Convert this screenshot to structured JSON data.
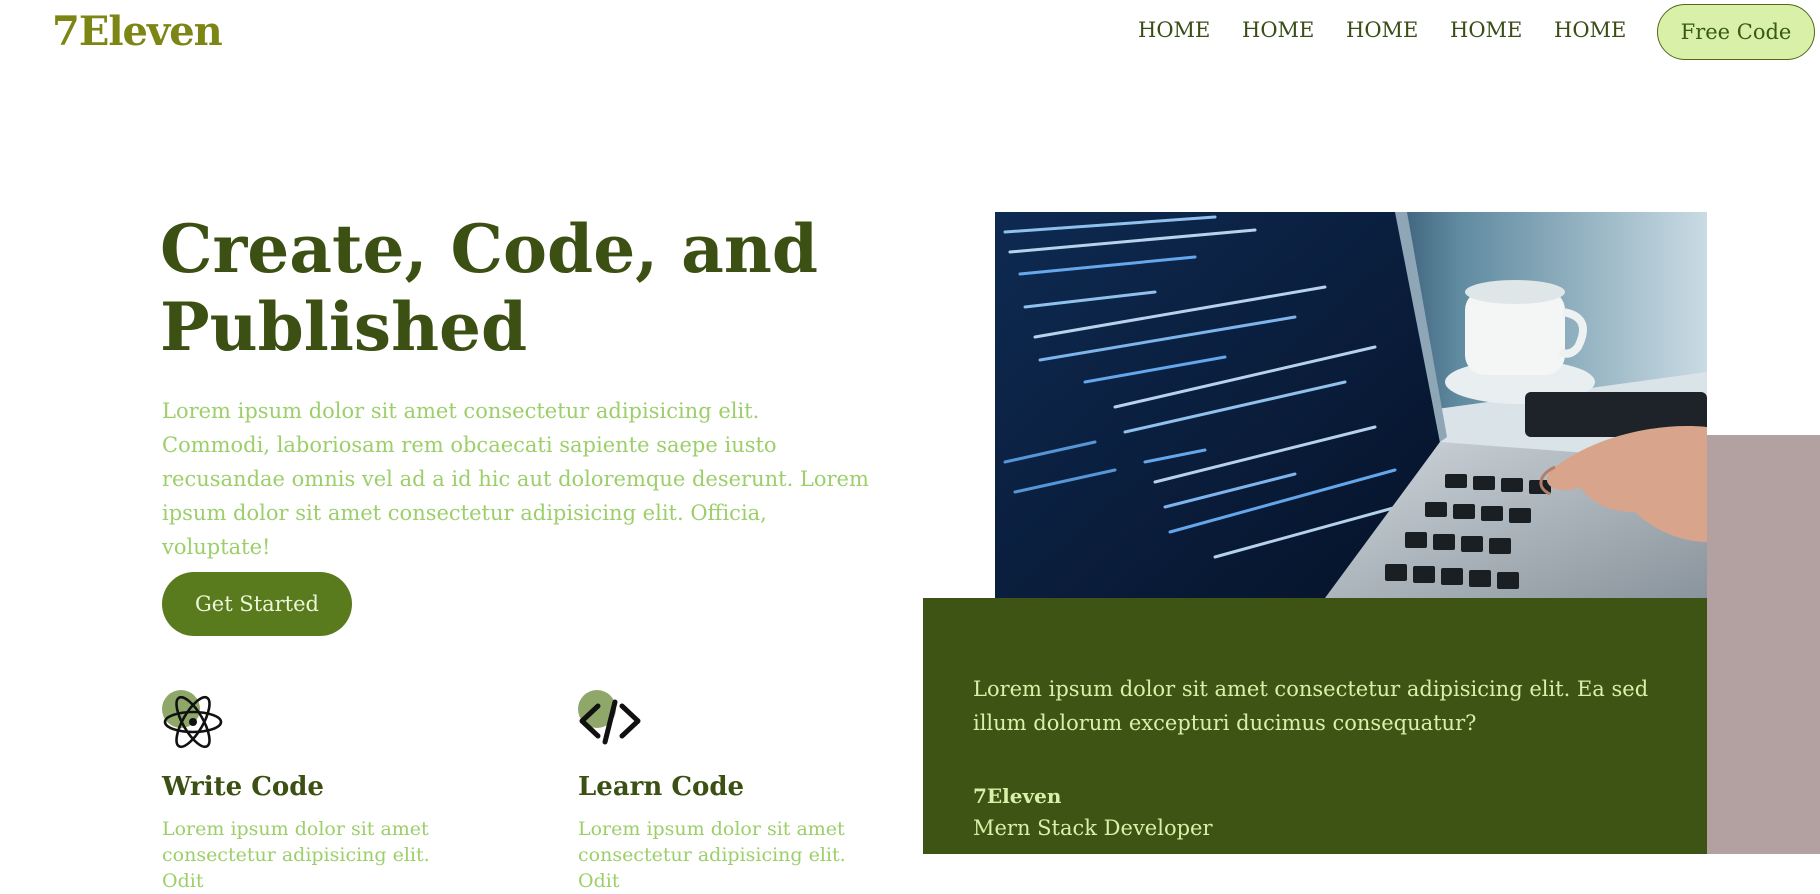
{
  "brand": {
    "logo": "7Eleven"
  },
  "nav": {
    "items": [
      "HOME",
      "HOME",
      "HOME",
      "HOME",
      "HOME"
    ],
    "cta_label": "Free Code"
  },
  "hero": {
    "title": "Create, Code, and Published",
    "description": "Lorem ipsum dolor sit amet consectetur adipisicing elit. Commodi, laboriosam rem obcaecati sapiente saepe iusto recusandae omnis vel ad a id hic aut doloremque deserunt. Lorem ipsum dolor sit amet consectetur adipisicing elit. Officia, voluptate!",
    "button_label": "Get Started",
    "image_icon": "laptop-code-photo"
  },
  "features": [
    {
      "icon": "atom-icon",
      "title": "Write Code",
      "text": "Lorem ipsum dolor sit amet consectetur adipisicing elit. Odit"
    },
    {
      "icon": "code-brackets-icon",
      "title": "Learn Code",
      "text": "Lorem ipsum dolor sit amet consectetur adipisicing elit. Odit"
    }
  ],
  "testimonial": {
    "quote": "Lorem ipsum dolor sit amet consectetur adipisicing elit. Ea sed illum dolorum excepturi ducimus consequatur?",
    "author": "7Eleven",
    "role": "Mern Stack Developer"
  },
  "colors": {
    "brand": "#7d8514",
    "heading": "#3b5012",
    "text_light_green": "#9ccf6a",
    "button": "#5a7a1e",
    "card_bg": "#3e5415",
    "cta_bg": "#d8f0a8",
    "mauve": "#b3a0a0"
  }
}
